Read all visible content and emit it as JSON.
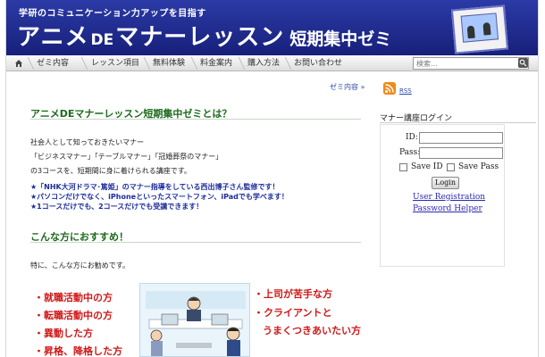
{
  "header": {
    "tagline": "学研のコミュニケーション力アップを目指す",
    "title_part1": "アニメ",
    "title_de": "DE",
    "title_part2": "マナーレッスン",
    "title_sub": "短期集中ゼミ",
    "colors": {
      "banner_top": "#2b3aa6",
      "banner_bottom": "#17207a"
    }
  },
  "nav": {
    "home_icon": "home-icon",
    "items": [
      "ゼミ内容",
      "レッスン項目",
      "無料体験",
      "料金案内",
      "購入方法",
      "お問い合わせ"
    ]
  },
  "search": {
    "placeholder": "検索...",
    "icon": "search-icon"
  },
  "content": {
    "breadcrumb": "ゼミ内容 »",
    "section1_title": "アニメDEマナーレッスン短期集中ゼミとは？",
    "para1": "社会人として知っておきたいマナー",
    "para2": "「ビジネスマナー」「テーブルマナー」「冠婚葬祭のマナー」",
    "para3": "の3コースを、短期間に身に着けられる講座です。",
    "notices": [
      "★「NHK大河ドラマ･篤姫」のマナー指導をしている西出博子さん監修です！",
      "★パソコンだけでなく、iPhoneといったスマートフォン、iPadでも学べます！",
      "★1コースだけでも、2コースだけでも受講できます！"
    ],
    "section2_title": "こんな方におすすめ！",
    "para4": "特に、こんな方にお勧めです。",
    "left_list": [
      "・就職活動中の方",
      "・転職活動中の方",
      "・異動した方",
      "・昇格、降格した方"
    ],
    "right_list": [
      "・上司が苦手な方",
      "・クライアントと",
      "うまくつきあいたい方"
    ],
    "accent_green": "#1d6a1d",
    "accent_red": "#d01818",
    "accent_blue": "#1c2c9c"
  },
  "sidebar": {
    "rss_icon": "rss-icon",
    "rss_label": "RSS",
    "login_title": "マナー講座ログイン",
    "id_label": "ID:",
    "password_label": "Pass:",
    "save_id_label": "Save ID",
    "save_pass_label": "Save Pass",
    "login_button": "Login",
    "register_link": "User Registration",
    "password_helper_link": "Password Helper"
  }
}
